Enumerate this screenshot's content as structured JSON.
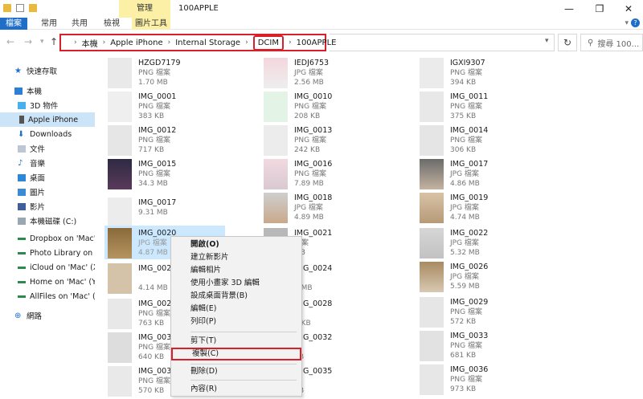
{
  "window": {
    "title": "100APPLE",
    "manage_tab": "管理",
    "minimize": "—",
    "maximize": "❐",
    "close": "✕"
  },
  "ribbon": {
    "tabs": [
      "檔案",
      "常用",
      "共用",
      "檢視",
      "圖片工具"
    ]
  },
  "address": {
    "crumbs": [
      "本機",
      "Apple iPhone",
      "Internal Storage",
      "DCIM",
      "100APPLE"
    ],
    "search_placeholder": "搜尋 100..."
  },
  "sidebar": {
    "items": [
      {
        "label": "快速存取",
        "icon": "star-icon"
      },
      {
        "label": "本機",
        "icon": "pc-icon"
      },
      {
        "label": "3D 物件",
        "icon": "cube-icon"
      },
      {
        "label": "Apple iPhone",
        "icon": "phone-icon"
      },
      {
        "label": "Downloads",
        "icon": "download-icon"
      },
      {
        "label": "文件",
        "icon": "document-icon"
      },
      {
        "label": "音樂",
        "icon": "music-icon"
      },
      {
        "label": "桌面",
        "icon": "desktop-icon"
      },
      {
        "label": "圖片",
        "icon": "pictures-icon"
      },
      {
        "label": "影片",
        "icon": "videos-icon"
      },
      {
        "label": "本機磁碟 (C:)",
        "icon": "disk-icon"
      },
      {
        "label": "Dropbox on 'Mac' (",
        "icon": "network-drive-icon"
      },
      {
        "label": "Photo Library on 'M",
        "icon": "network-drive-icon"
      },
      {
        "label": "iCloud on 'Mac' (X:",
        "icon": "network-drive-icon"
      },
      {
        "label": "Home on 'Mac' (Y:)",
        "icon": "network-drive-icon"
      },
      {
        "label": "AllFiles on 'Mac' (Z",
        "icon": "network-drive-icon"
      },
      {
        "label": "網路",
        "icon": "network-icon"
      }
    ]
  },
  "files": {
    "col1": [
      {
        "name": "HZGD7179",
        "type": "PNG 檔案",
        "size": "1.70 MB"
      },
      {
        "name": "IMG_0001",
        "type": "PNG 檔案",
        "size": "383 KB"
      },
      {
        "name": "IMG_0012",
        "type": "PNG 檔案",
        "size": "717 KB"
      },
      {
        "name": "IMG_0015",
        "type": "PNG 檔案",
        "size": "34.3 MB"
      },
      {
        "name": "IMG_0017",
        "type": "",
        "size": "9.31 MB"
      },
      {
        "name": "IMG_0020",
        "type": "JPG 檔案",
        "size": "4.87 MB"
      },
      {
        "name": "IMG_002",
        "type": "",
        "size": "4.14 MB"
      },
      {
        "name": "IMG_002",
        "type": "PNG 檔案",
        "size": "763 KB"
      },
      {
        "name": "IMG_003",
        "type": "PNG 檔案",
        "size": "640 KB"
      },
      {
        "name": "IMG_003",
        "type": "PNG 檔案",
        "size": "570 KB"
      }
    ],
    "col2": [
      {
        "name": "IEDJ6753",
        "type": "JPG 檔案",
        "size": "2.56 MB"
      },
      {
        "name": "IMG_0010",
        "type": "PNG 檔案",
        "size": "208 KB"
      },
      {
        "name": "IMG_0013",
        "type": "PNG 檔案",
        "size": "242 KB"
      },
      {
        "name": "IMG_0016",
        "type": "PNG 檔案",
        "size": "7.89 MB"
      },
      {
        "name": "IMG_0018",
        "type": "JPG 檔案",
        "size": "4.89 MB"
      },
      {
        "name": "IMG_0021",
        "type": "檔案",
        "size": "MB"
      },
      {
        "name": "IMG_0024",
        "type": "",
        "size": "0 MB"
      },
      {
        "name": "IMG_0028",
        "type": "案",
        "size": "5 KB"
      },
      {
        "name": "IMG_0032",
        "type": "案",
        "size": "KB"
      },
      {
        "name": "IMG_0035",
        "type": "案",
        "size": "KB"
      }
    ],
    "col3": [
      {
        "name": "IGXI9307",
        "type": "PNG 檔案",
        "size": "394 KB"
      },
      {
        "name": "IMG_0011",
        "type": "PNG 檔案",
        "size": "375 KB"
      },
      {
        "name": "IMG_0014",
        "type": "PNG 檔案",
        "size": "306 KB"
      },
      {
        "name": "IMG_0017",
        "type": "JPG 檔案",
        "size": "4.86 MB"
      },
      {
        "name": "IMG_0019",
        "type": "JPG 檔案",
        "size": "4.74 MB"
      },
      {
        "name": "IMG_0022",
        "type": "JPG 檔案",
        "size": "5.32 MB"
      },
      {
        "name": "IMG_0026",
        "type": "JPG 檔案",
        "size": "5.59 MB"
      },
      {
        "name": "IMG_0029",
        "type": "PNG 檔案",
        "size": "572 KB"
      },
      {
        "name": "IMG_0033",
        "type": "PNG 檔案",
        "size": "681 KB"
      },
      {
        "name": "IMG_0036",
        "type": "PNG 檔案",
        "size": "973 KB"
      }
    ]
  },
  "context_menu": {
    "items": [
      "開啟(O)",
      "建立新影片",
      "編輯相片",
      "使用小畫家 3D 編輯",
      "設成桌面背景(B)",
      "編輯(E)",
      "列印(P)",
      "剪下(T)",
      "複製(C)",
      "刪除(D)",
      "內容(R)"
    ]
  },
  "colors": {
    "accent": "#1f6fc9",
    "highlight_outline": "#d9202a",
    "selection": "#cce8ff",
    "manage_tab": "#fbf0a6"
  }
}
